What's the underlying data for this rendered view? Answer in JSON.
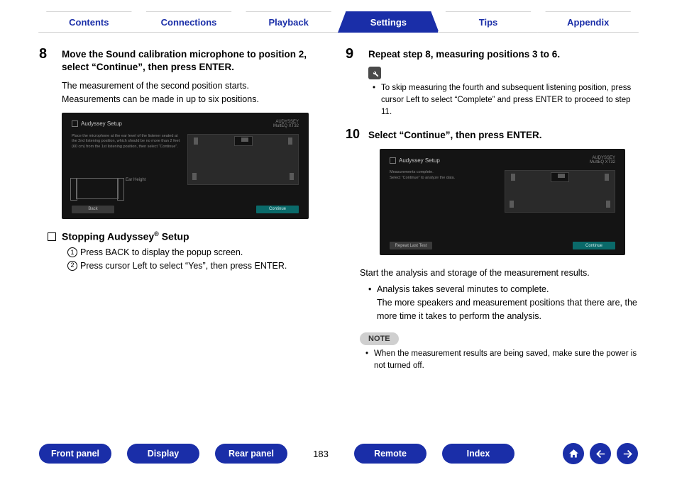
{
  "top_tabs": [
    "Contents",
    "Connections",
    "Playback",
    "Settings",
    "Tips",
    "Appendix"
  ],
  "top_tabs_active_index": 3,
  "left": {
    "step8": {
      "num": "8",
      "title": "Move the Sound calibration microphone to position 2, select “Continue”, then press ENTER.",
      "line1": "The measurement of the second position starts.",
      "line2": "Measurements can be made in up to six positions."
    },
    "tv1": {
      "title": "Audyssey Setup",
      "instr": "Place the microphone at the ear level of the listener seated at the 2nd listening position, which should be no more than 2 feet (60 cm) from the 1st listening position, then select “Continue”.",
      "ear": "Ear Height",
      "back": "Back",
      "cont": "Continue"
    },
    "sub_heading": "Stopping Audyssey",
    "sub_heading_reg": "®",
    "sub_heading_tail": " Setup",
    "circled": [
      "Press BACK to display the popup screen.",
      "Press cursor Left to select “Yes”, then press ENTER."
    ]
  },
  "right": {
    "step9": {
      "num": "9",
      "title": "Repeat step 8, measuring positions 3 to 6.",
      "tip": "To skip measuring the fourth and subsequent listening position, press cursor Left to select “Complete” and press ENTER to proceed to step 11."
    },
    "step10": {
      "num": "10",
      "title": "Select “Continue”, then press ENTER."
    },
    "tv2": {
      "title": "Audyssey Setup",
      "msg1": "Measurements complete.",
      "msg2": "Select “Continue” to analyze the data.",
      "repeat": "Repeat Last Test",
      "cont": "Continue"
    },
    "after_tv": "Start the analysis and storage of the measurement results.",
    "bullet1": "Analysis takes several minutes to complete.",
    "bullet1b": "The more speakers and measurement positions that there are, the more time it takes to perform the analysis.",
    "note_label": "NOTE",
    "note_bullet": "When the measurement results are being saved, make sure the power is not turned off."
  },
  "bottom": {
    "buttons": [
      "Front panel",
      "Display",
      "Rear panel",
      "Remote",
      "Index"
    ],
    "page": "183"
  }
}
